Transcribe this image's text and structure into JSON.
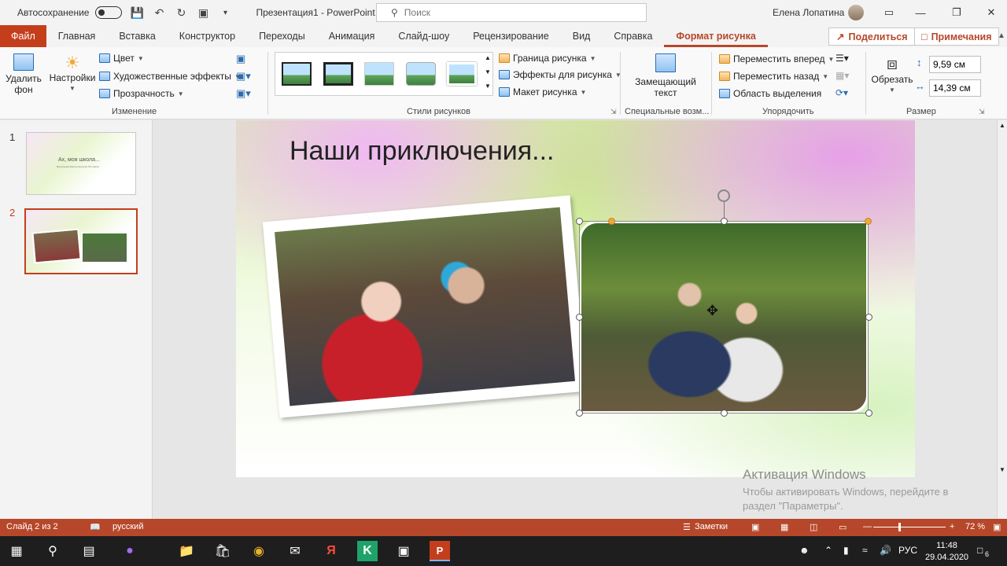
{
  "titlebar": {
    "autosave": "Автосохранение",
    "doc_title": "Презентация1  -  PowerPoint",
    "search_placeholder": "Поиск",
    "user": "Елена Лопатина"
  },
  "tabs": [
    "Файл",
    "Главная",
    "Вставка",
    "Конструктор",
    "Переходы",
    "Анимация",
    "Слайд-шоу",
    "Рецензирование",
    "Вид",
    "Справка",
    "Формат рисунка"
  ],
  "share": "Поделиться",
  "comments": "Примечания",
  "ribbon": {
    "remove_bg": [
      "Удалить",
      "фон"
    ],
    "corrections": "Настройки",
    "color": "Цвет",
    "artistic": "Художественные эффекты",
    "transparency": "Прозрачность",
    "group_adjust": "Изменение",
    "border": "Граница рисунка",
    "effects": "Эффекты для рисунка",
    "layout": "Макет рисунка",
    "group_styles": "Стили рисунков",
    "alt_text": [
      "Замещающий",
      "текст"
    ],
    "group_access": "Специальные возм...",
    "bring_forward": "Переместить вперед",
    "send_backward": "Переместить назад",
    "selection_pane": "Область выделения",
    "group_arrange": "Упорядочить",
    "crop": "Обрезать",
    "height": "9,59 см",
    "width": "14,39 см",
    "group_size": "Размер"
  },
  "thumbnails": [
    {
      "num": "1",
      "title": "Ах, моя школа...",
      "subtitle": "Выпускники Школы выпуска 7Б класса"
    },
    {
      "num": "2"
    }
  ],
  "slide": {
    "title": "Наши приключения..."
  },
  "watermark": {
    "line1": "Активация Windows",
    "line2": "Чтобы активировать Windows, перейдите в",
    "line3": "раздел \"Параметры\"."
  },
  "status": {
    "slide_counter": "Слайд 2 из 2",
    "language": "русский",
    "notes": "Заметки",
    "zoom": "72 %"
  },
  "taskbar": {
    "lang": "РУС",
    "time": "11:48",
    "date": "29.04.2020",
    "notifications": "6"
  },
  "colors": {
    "accent": "#b7472a",
    "file_tab": "#c43e1c"
  }
}
